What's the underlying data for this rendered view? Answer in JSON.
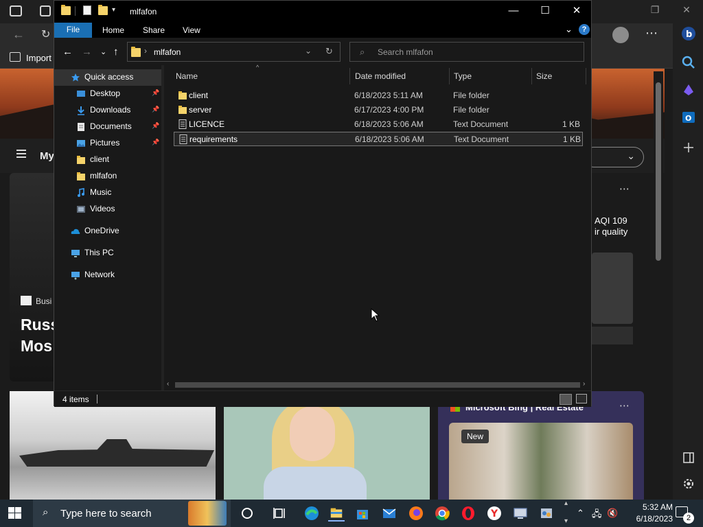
{
  "browser": {
    "favorites_bar": {
      "import_label": "Import"
    },
    "nav": {
      "my_feed_label": "My"
    },
    "news_left": {
      "source": "Busi",
      "headline_line1": "Russ",
      "headline_line2": "Mos"
    },
    "weather": {
      "aqi": "AQI 109",
      "air_quality": "ir quality"
    },
    "card3": {
      "title": "Microsoft Bing | Real Estate",
      "badge": "New"
    }
  },
  "explorer": {
    "title": "mlfafon",
    "ribbon": {
      "file": "File",
      "tabs": [
        "Home",
        "Share",
        "View"
      ]
    },
    "address": {
      "crumb": "mlfafon"
    },
    "search": {
      "placeholder": "Search mlfafon"
    },
    "nav_pane": [
      {
        "label": "Quick access",
        "icon": "star-icon",
        "pinned": false,
        "level": 0
      },
      {
        "label": "Desktop",
        "icon": "desktop-icon",
        "pinned": true,
        "level": 1
      },
      {
        "label": "Downloads",
        "icon": "download-icon",
        "pinned": true,
        "level": 1
      },
      {
        "label": "Documents",
        "icon": "documents-icon",
        "pinned": true,
        "level": 1
      },
      {
        "label": "Pictures",
        "icon": "pictures-icon",
        "pinned": true,
        "level": 1
      },
      {
        "label": "client",
        "icon": "folder-icon",
        "pinned": false,
        "level": 1
      },
      {
        "label": "mlfafon",
        "icon": "folder-icon",
        "pinned": false,
        "level": 1
      },
      {
        "label": "Music",
        "icon": "music-icon",
        "pinned": false,
        "level": 1
      },
      {
        "label": "Videos",
        "icon": "videos-icon",
        "pinned": false,
        "level": 1
      },
      {
        "label": "OneDrive",
        "icon": "onedrive-icon",
        "pinned": false,
        "level": 0
      },
      {
        "label": "This PC",
        "icon": "pc-icon",
        "pinned": false,
        "level": 0
      },
      {
        "label": "Network",
        "icon": "network-icon",
        "pinned": false,
        "level": 0
      }
    ],
    "columns": {
      "name": "Name",
      "date": "Date modified",
      "type": "Type",
      "size": "Size"
    },
    "files": [
      {
        "name": "client",
        "date": "6/18/2023 5:11 AM",
        "type": "File folder",
        "size": "",
        "kind": "folder"
      },
      {
        "name": "server",
        "date": "6/17/2023 4:00 PM",
        "type": "File folder",
        "size": "",
        "kind": "folder"
      },
      {
        "name": "LICENCE",
        "date": "6/18/2023 5:06 AM",
        "type": "Text Document",
        "size": "1 KB",
        "kind": "text"
      },
      {
        "name": "requirements",
        "date": "6/18/2023 5:06 AM",
        "type": "Text Document",
        "size": "1 KB",
        "kind": "text"
      }
    ],
    "status": {
      "item_count": "4 items"
    }
  },
  "taskbar": {
    "search_placeholder": "Type here to search",
    "clock_time": "5:32 AM",
    "clock_date": "6/18/2023",
    "notification_count": "2"
  },
  "colors": {
    "accent": "#1a6fb4",
    "folder": "#f5d36a",
    "taskbar": "#1f2a33"
  }
}
